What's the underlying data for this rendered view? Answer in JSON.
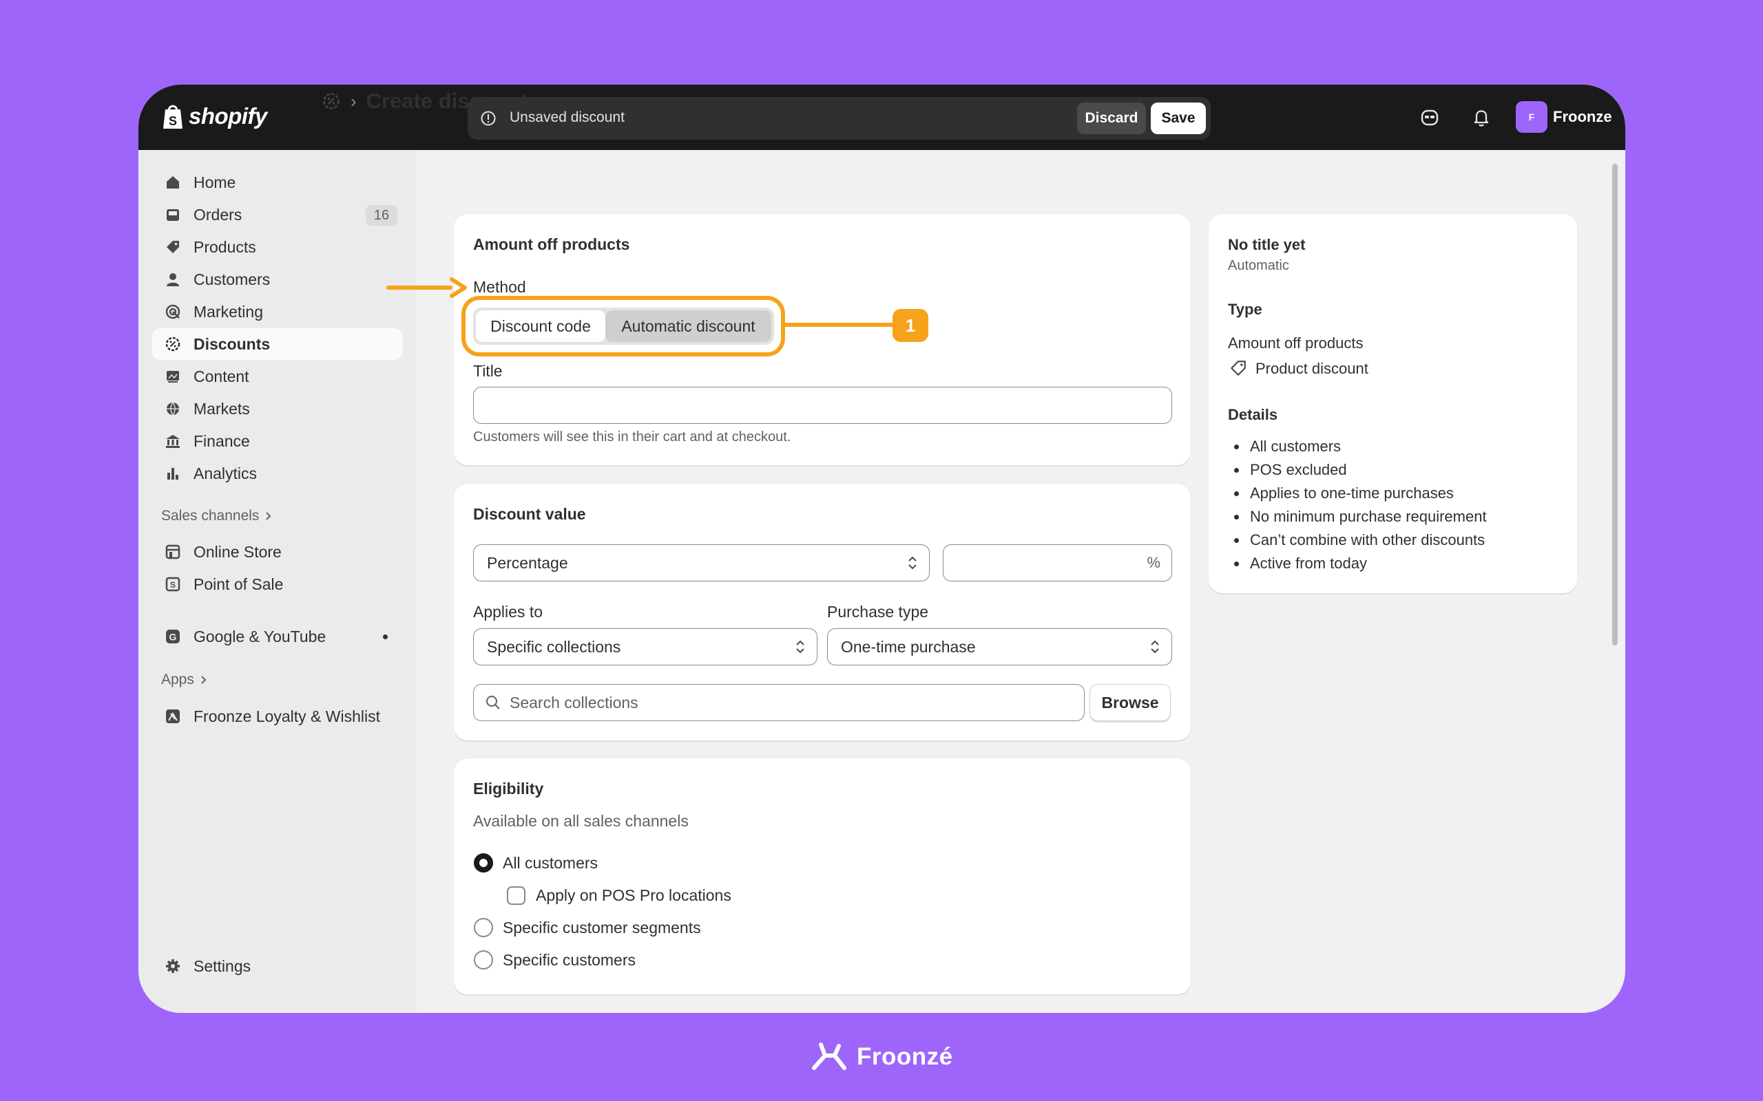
{
  "app": {
    "logo_text": "shopify"
  },
  "topbar": {
    "unsaved_label": "Unsaved discount",
    "discard_label": "Discard",
    "save_label": "Save",
    "avatar_initial": "F",
    "user_name": "Froonze"
  },
  "sidebar": {
    "items": [
      {
        "label": "Home",
        "icon": "home-icon"
      },
      {
        "label": "Orders",
        "icon": "orders-icon",
        "badge": "16"
      },
      {
        "label": "Products",
        "icon": "tag-icon"
      },
      {
        "label": "Customers",
        "icon": "person-icon"
      },
      {
        "label": "Marketing",
        "icon": "target-icon"
      },
      {
        "label": "Discounts",
        "icon": "discount-icon",
        "active": true
      },
      {
        "label": "Content",
        "icon": "image-icon"
      },
      {
        "label": "Markets",
        "icon": "globe-icon"
      },
      {
        "label": "Finance",
        "icon": "bank-icon"
      },
      {
        "label": "Analytics",
        "icon": "bar-chart-icon"
      }
    ],
    "sales_channels_label": "Sales channels",
    "channels": [
      {
        "label": "Online Store",
        "icon": "store-icon"
      },
      {
        "label": "Point of Sale",
        "icon": "pos-icon"
      },
      {
        "label": "Google & YouTube",
        "icon": "google-icon"
      }
    ],
    "apps_label": "Apps",
    "apps": [
      {
        "label": "Froonze Loyalty & Wishlist",
        "icon": "froonze-icon"
      }
    ],
    "settings_label": "Settings"
  },
  "page": {
    "title": "Create discount"
  },
  "method_card": {
    "title": "Amount off products",
    "method_label": "Method",
    "segment_code": "Discount code",
    "segment_auto": "Automatic discount",
    "title_label": "Title",
    "title_value": "",
    "title_help": "Customers will see this in their cart and at checkout.",
    "annotation_number": "1"
  },
  "value_card": {
    "title": "Discount value",
    "type_value": "Percentage",
    "percent_suffix": "%",
    "percent_value": "",
    "applies_to_label": "Applies to",
    "applies_to_value": "Specific collections",
    "purchase_type_label": "Purchase type",
    "purchase_type_value": "One-time purchase",
    "search_placeholder": "Search collections",
    "browse_label": "Browse"
  },
  "eligibility_card": {
    "title": "Eligibility",
    "subtitle": "Available on all sales channels",
    "option_all": "All customers",
    "option_pos": "Apply on POS Pro locations",
    "option_segments": "Specific customer segments",
    "option_specific": "Specific customers"
  },
  "summary_card": {
    "title": "No title yet",
    "subtitle": "Automatic",
    "type_heading": "Type",
    "type_value": "Amount off products",
    "type_sub": "Product discount",
    "details_heading": "Details",
    "details": [
      "All customers",
      "POS excluded",
      "Applies to one-time purchases",
      "No minimum purchase requirement",
      "Can’t combine with other discounts",
      "Active from today"
    ]
  },
  "footer": {
    "brand": "Froonzé"
  },
  "colors": {
    "background": "#9E65FB",
    "annotation": "#F7A21B",
    "topbar": "#1a1a1a"
  }
}
